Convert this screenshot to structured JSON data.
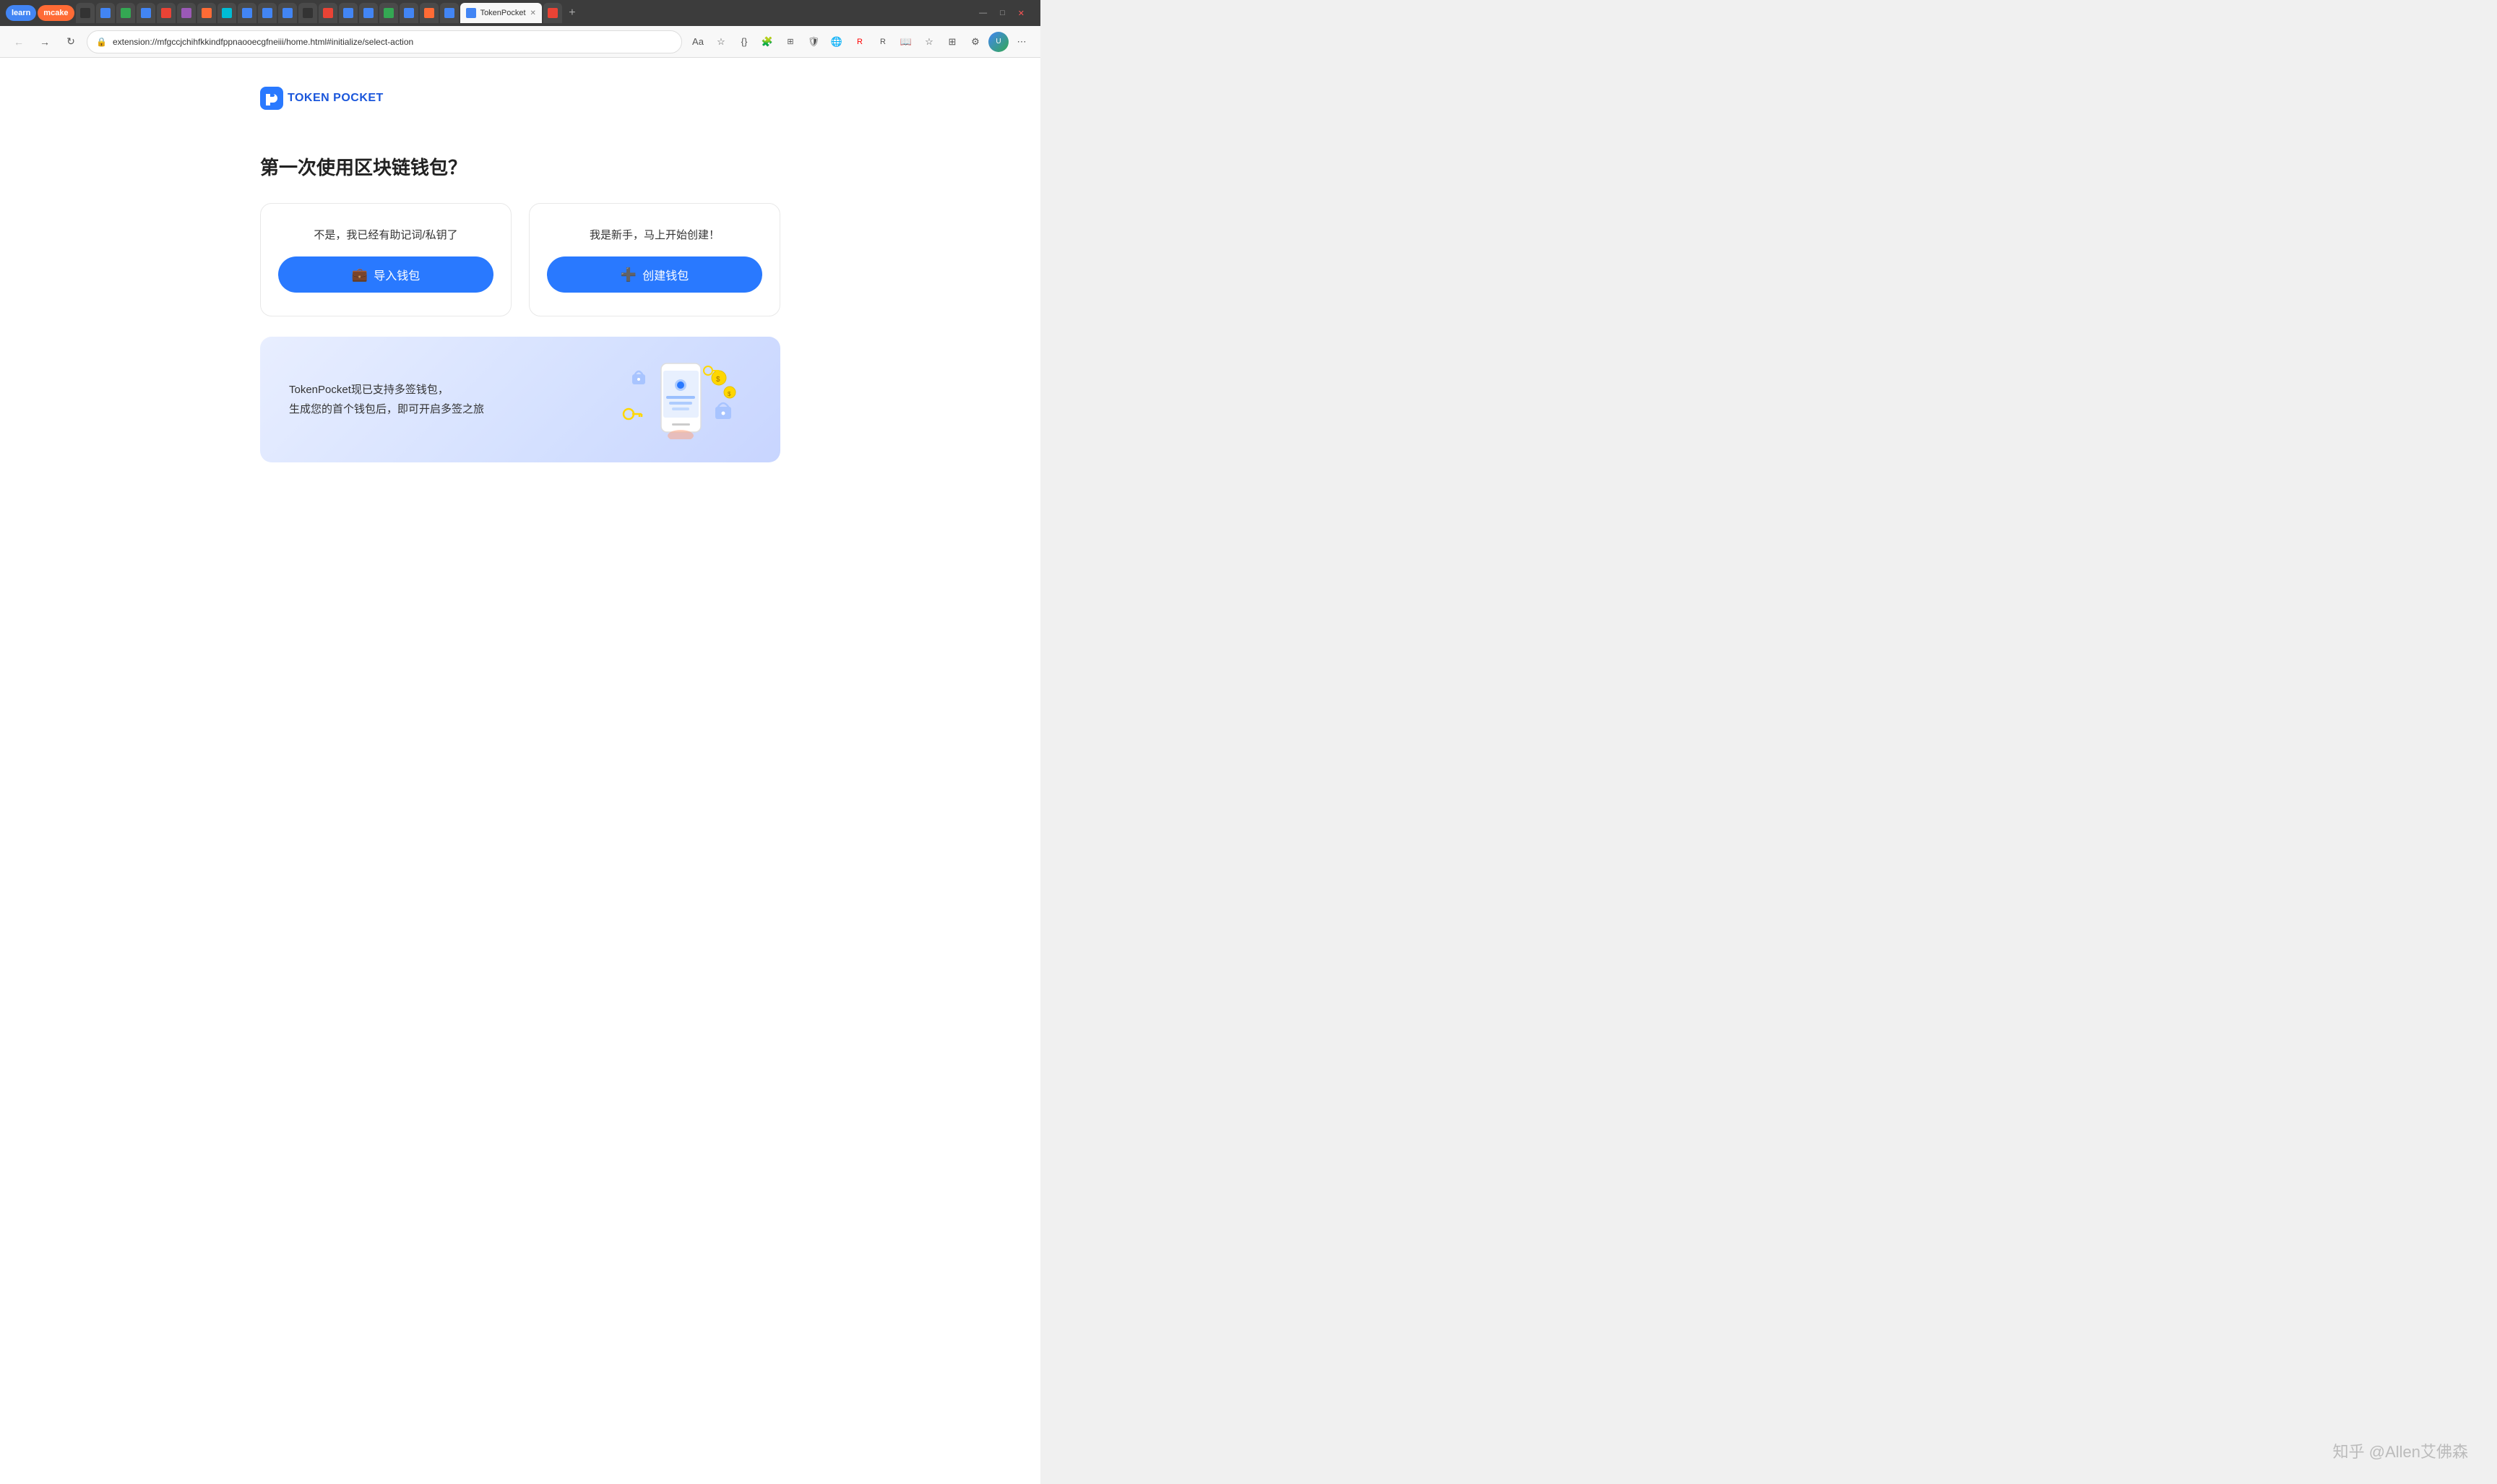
{
  "browser": {
    "tabs": [
      {
        "id": "learn",
        "label": "learn",
        "type": "colored-learn",
        "active": false
      },
      {
        "id": "mcake",
        "label": "mcake",
        "type": "colored-mcake",
        "active": false
      },
      {
        "id": "t1",
        "label": "",
        "type": "icon-only",
        "active": false
      },
      {
        "id": "t2",
        "label": "",
        "type": "icon-only",
        "active": false
      },
      {
        "id": "t3",
        "label": "",
        "type": "icon-only",
        "active": false
      },
      {
        "id": "t4",
        "label": "",
        "type": "icon-only",
        "active": false
      },
      {
        "id": "t5",
        "label": "",
        "type": "icon-only",
        "active": false
      },
      {
        "id": "active-tab",
        "label": "TokenPocket",
        "type": "active",
        "active": true
      }
    ],
    "address": "extension://mfgccjchihfkkindfppnaooecgfneiii/home.html#initialize/select-action",
    "window_controls": [
      "—",
      "□",
      "✕"
    ]
  },
  "logo": {
    "text": "TOKEN POCKET"
  },
  "page": {
    "title": "第一次使用区块链钱包？",
    "card_left": {
      "subtitle": "不是，我已经有助记词/私钥了",
      "button_label": "导入钱包",
      "button_icon": "💼"
    },
    "card_right": {
      "subtitle": "我是新手，马上开始创建！",
      "button_label": "创建钱包",
      "button_icon": "➕"
    },
    "banner": {
      "line1": "TokenPocket现已支持多签钱包，",
      "line2": "生成您的首个钱包后，即可开启多签之旅"
    }
  },
  "watermark": {
    "text": "知乎 @Allen艾佛森"
  }
}
